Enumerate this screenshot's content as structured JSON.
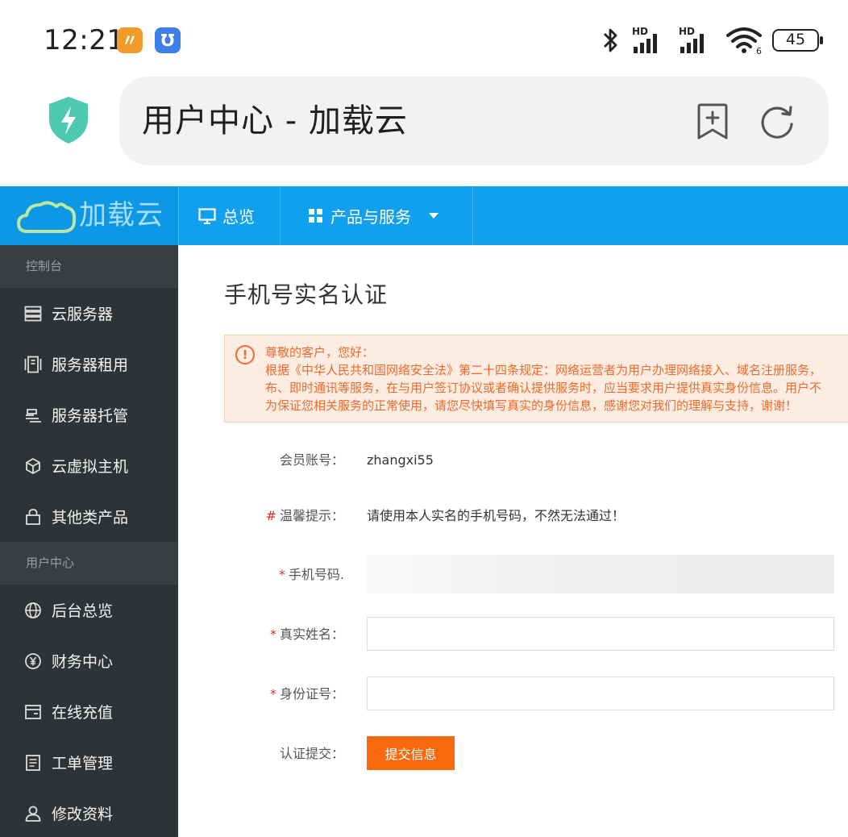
{
  "status_bar": {
    "time": "12:21",
    "app_icons": [
      "taobao-badge-icon",
      "alarm-badge-icon"
    ],
    "network_left": "HD",
    "network_right": "HD",
    "wifi_sub": "6",
    "battery": "45"
  },
  "browser": {
    "title": "用户中心 - 加载云",
    "security_icon": "shield-bolt-icon",
    "bookmark_icon": "bookmark-add-icon",
    "reload_icon": "reload-icon"
  },
  "site": {
    "logo_text": "加载云",
    "nav": [
      {
        "label": "总览",
        "icon": "monitor-icon"
      },
      {
        "label": "产品与服务",
        "icon": "grid-icon"
      }
    ]
  },
  "sidebar": {
    "section_console": "控制台",
    "console_items": [
      {
        "label": "云服务器",
        "icon": "server-icon"
      },
      {
        "label": "服务器租用",
        "icon": "rack-icon"
      },
      {
        "label": "服务器托管",
        "icon": "hosting-icon"
      },
      {
        "label": "云虚拟主机",
        "icon": "cube-icon"
      },
      {
        "label": "其他类产品",
        "icon": "lock-icon"
      }
    ],
    "section_user": "用户中心",
    "user_items": [
      {
        "label": "后台总览",
        "icon": "globe-icon"
      },
      {
        "label": "财务中心",
        "icon": "yen-icon"
      },
      {
        "label": "在线充值",
        "icon": "wallet-icon"
      },
      {
        "label": "工单管理",
        "icon": "document-icon"
      },
      {
        "label": "修改资料",
        "icon": "user-icon"
      }
    ]
  },
  "main": {
    "heading": "手机号实名认证",
    "notice": {
      "line1": "尊敬的客户，您好：",
      "line2": "根据《中华人民共和国网络安全法》第二十四条规定：网络运营者为用户办理网络接入、域名注册服务，",
      "line3": "布、即时通讯等服务，在与用户签订协议或者确认提供服务时，应当要求用户提供真实身份信息。用户不",
      "line4": "为保证您相关服务的正常使用，请您尽快填写真实的身份信息，感谢您对我们的理解与支持，谢谢！"
    },
    "form": {
      "account_label": "会员账号：",
      "account_value": "zhangxi55",
      "tip_mark": "#",
      "tip_label": "温馨提示：",
      "tip_value": "请使用本人实名的手机号码，不然无法通过！",
      "required_mark": "*",
      "phone_label": "手机号码.",
      "phone_value": "",
      "name_label": "真实姓名：",
      "name_value": "",
      "id_label": "身份证号：",
      "id_value": "",
      "submit_label": "认证提交：",
      "submit_button": "提交信息"
    }
  },
  "colors": {
    "header_blue": "#11a0ef",
    "sidebar_dark": "#303335",
    "notice_orange": "#ef6a2a",
    "button_orange": "#f86a0d"
  }
}
